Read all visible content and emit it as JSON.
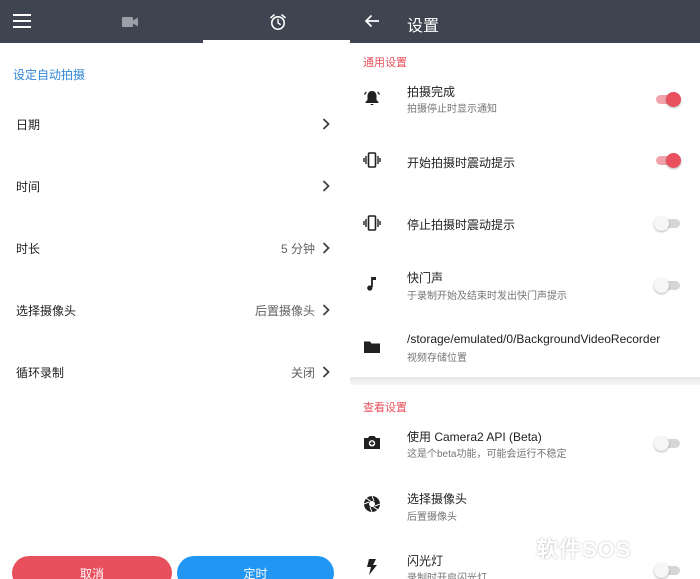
{
  "left": {
    "section_title": "设定自动拍摄",
    "rows": [
      {
        "label": "日期",
        "value": ""
      },
      {
        "label": "时间",
        "value": ""
      },
      {
        "label": "时长",
        "value": "5 分钟"
      },
      {
        "label": "选择摄像头",
        "value": "后置摄像头"
      },
      {
        "label": "循环录制",
        "value": "关闭"
      }
    ],
    "cancel_label": "取消",
    "confirm_label": "定时"
  },
  "right": {
    "title": "设置",
    "general": {
      "header": "通用设置",
      "items": [
        {
          "title": "拍摄完成",
          "subtitle": "拍摄停止时显示通知",
          "icon": "bell-icon",
          "switch": "on"
        },
        {
          "title": "开始拍摄时震动提示",
          "subtitle": "",
          "icon": "vibrate-icon",
          "switch": "on"
        },
        {
          "title": "停止拍摄时震动提示",
          "subtitle": "",
          "icon": "vibrate-icon",
          "switch": "off"
        },
        {
          "title": "快门声",
          "subtitle": "于录制开始及结束时发出快门声提示",
          "icon": "music-note-icon",
          "switch": "off"
        },
        {
          "title": "/storage/emulated/0/BackgroundVideoRecorder",
          "subtitle": "视频存储位置",
          "icon": "folder-icon",
          "switch": ""
        }
      ]
    },
    "view": {
      "header": "查看设置",
      "items": [
        {
          "title": "使用 Camera2 API (Beta)",
          "subtitle": "这是个beta功能，可能会运行不稳定",
          "icon": "camera-switch-icon",
          "switch": "off"
        },
        {
          "title": "选择摄像头",
          "subtitle": "后置摄像头",
          "icon": "aperture-icon",
          "switch": ""
        },
        {
          "title": "闪光灯",
          "subtitle": "录制时开启闪光灯",
          "icon": "flash-icon",
          "switch": "off"
        }
      ]
    }
  },
  "watermark": {
    "text": "软件SOS"
  },
  "colors": {
    "toolbar": "#3e4550",
    "accent_red": "#e8505e",
    "accent_blue": "#2196f3",
    "section_blue": "#2f86d6"
  }
}
